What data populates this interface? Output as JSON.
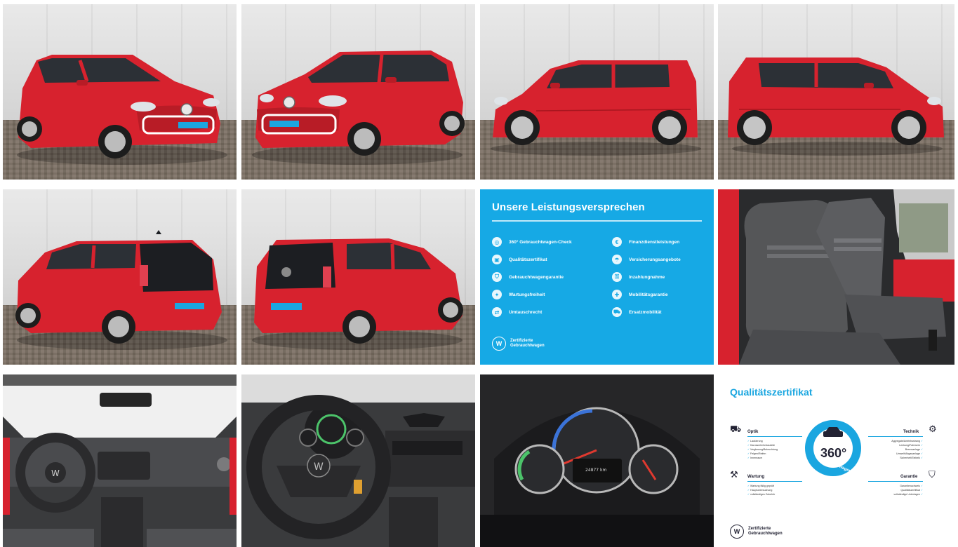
{
  "gallery": {
    "accent_color": "#16a9e5",
    "car_color": "#d7222e",
    "promise": {
      "title": "Unsere Leistungsversprechen",
      "items": [
        "360° Gebrauchtwagen-Check",
        "Qualitätszertifikat",
        "Gebrauchtwagengarantie",
        "Wartungsfreiheit",
        "Umtauschrecht",
        "Finanzdienstleistungen",
        "Versicherungsangebote",
        "Inzahlungnahme",
        "Mobilitätsgarantie",
        "Ersatzmobilität"
      ],
      "logo_line1": "Zertifizierte",
      "logo_line2": "Gebrauchtwagen"
    },
    "certificate": {
      "title": "Qualitätszertifikat",
      "optik": {
        "heading": "Optik",
        "items": [
          "Lackierung",
          "Karosserie/Anbauteile",
          "Verglasung/Beleuchtung",
          "Felgen/Reifen",
          "Innenraum"
        ]
      },
      "technik": {
        "heading": "Technik",
        "items": [
          "Aggregate/Antriebsstrang",
          "Lenkung/Fahrwerk",
          "Bremsanlage",
          "Umwelt/Abgasanlage",
          "Sicherheit/Elektrik"
        ]
      },
      "wartung": {
        "heading": "Wartung",
        "items": [
          "Wartung fällig geprüft",
          "Hauptuntersuchung",
          "vollständiges Zubehör"
        ]
      },
      "garantie": {
        "heading": "Garantie",
        "items": [
          "Garantienachweis",
          "Qualitätszertifikat",
          "vollständige Unterlagen"
        ]
      },
      "badge_value": "360°",
      "badge_text": "Gebrauchtwagen-Check",
      "logo_line1": "Zertifizierte",
      "logo_line2": "Gebrauchtwagen"
    },
    "dashboard": {
      "odometer": "24877 km"
    }
  }
}
